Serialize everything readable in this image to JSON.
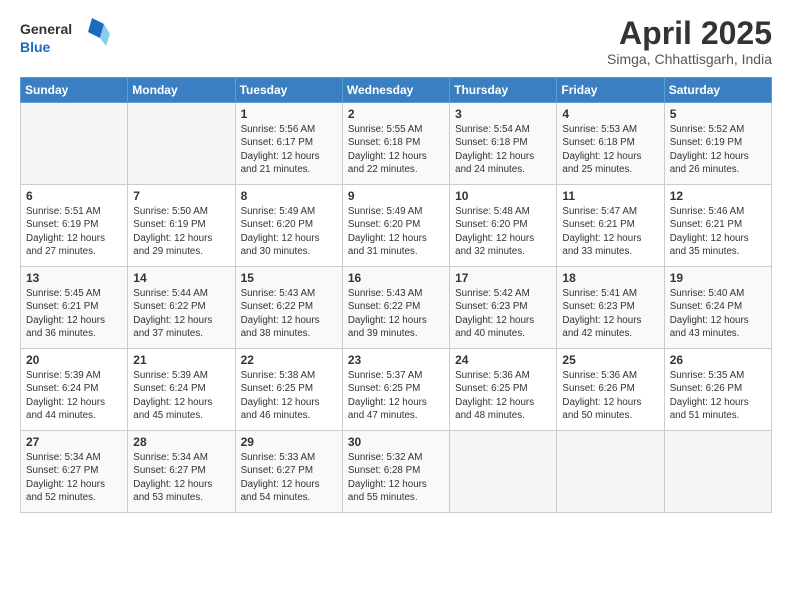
{
  "header": {
    "logo_general": "General",
    "logo_blue": "Blue",
    "month_title": "April 2025",
    "location": "Simga, Chhattisgarh, India"
  },
  "days_of_week": [
    "Sunday",
    "Monday",
    "Tuesday",
    "Wednesday",
    "Thursday",
    "Friday",
    "Saturday"
  ],
  "weeks": [
    [
      {
        "day": "",
        "info": ""
      },
      {
        "day": "",
        "info": ""
      },
      {
        "day": "1",
        "info": "Sunrise: 5:56 AM\nSunset: 6:17 PM\nDaylight: 12 hours and 21 minutes."
      },
      {
        "day": "2",
        "info": "Sunrise: 5:55 AM\nSunset: 6:18 PM\nDaylight: 12 hours and 22 minutes."
      },
      {
        "day": "3",
        "info": "Sunrise: 5:54 AM\nSunset: 6:18 PM\nDaylight: 12 hours and 24 minutes."
      },
      {
        "day": "4",
        "info": "Sunrise: 5:53 AM\nSunset: 6:18 PM\nDaylight: 12 hours and 25 minutes."
      },
      {
        "day": "5",
        "info": "Sunrise: 5:52 AM\nSunset: 6:19 PM\nDaylight: 12 hours and 26 minutes."
      }
    ],
    [
      {
        "day": "6",
        "info": "Sunrise: 5:51 AM\nSunset: 6:19 PM\nDaylight: 12 hours and 27 minutes."
      },
      {
        "day": "7",
        "info": "Sunrise: 5:50 AM\nSunset: 6:19 PM\nDaylight: 12 hours and 29 minutes."
      },
      {
        "day": "8",
        "info": "Sunrise: 5:49 AM\nSunset: 6:20 PM\nDaylight: 12 hours and 30 minutes."
      },
      {
        "day": "9",
        "info": "Sunrise: 5:49 AM\nSunset: 6:20 PM\nDaylight: 12 hours and 31 minutes."
      },
      {
        "day": "10",
        "info": "Sunrise: 5:48 AM\nSunset: 6:20 PM\nDaylight: 12 hours and 32 minutes."
      },
      {
        "day": "11",
        "info": "Sunrise: 5:47 AM\nSunset: 6:21 PM\nDaylight: 12 hours and 33 minutes."
      },
      {
        "day": "12",
        "info": "Sunrise: 5:46 AM\nSunset: 6:21 PM\nDaylight: 12 hours and 35 minutes."
      }
    ],
    [
      {
        "day": "13",
        "info": "Sunrise: 5:45 AM\nSunset: 6:21 PM\nDaylight: 12 hours and 36 minutes."
      },
      {
        "day": "14",
        "info": "Sunrise: 5:44 AM\nSunset: 6:22 PM\nDaylight: 12 hours and 37 minutes."
      },
      {
        "day": "15",
        "info": "Sunrise: 5:43 AM\nSunset: 6:22 PM\nDaylight: 12 hours and 38 minutes."
      },
      {
        "day": "16",
        "info": "Sunrise: 5:43 AM\nSunset: 6:22 PM\nDaylight: 12 hours and 39 minutes."
      },
      {
        "day": "17",
        "info": "Sunrise: 5:42 AM\nSunset: 6:23 PM\nDaylight: 12 hours and 40 minutes."
      },
      {
        "day": "18",
        "info": "Sunrise: 5:41 AM\nSunset: 6:23 PM\nDaylight: 12 hours and 42 minutes."
      },
      {
        "day": "19",
        "info": "Sunrise: 5:40 AM\nSunset: 6:24 PM\nDaylight: 12 hours and 43 minutes."
      }
    ],
    [
      {
        "day": "20",
        "info": "Sunrise: 5:39 AM\nSunset: 6:24 PM\nDaylight: 12 hours and 44 minutes."
      },
      {
        "day": "21",
        "info": "Sunrise: 5:39 AM\nSunset: 6:24 PM\nDaylight: 12 hours and 45 minutes."
      },
      {
        "day": "22",
        "info": "Sunrise: 5:38 AM\nSunset: 6:25 PM\nDaylight: 12 hours and 46 minutes."
      },
      {
        "day": "23",
        "info": "Sunrise: 5:37 AM\nSunset: 6:25 PM\nDaylight: 12 hours and 47 minutes."
      },
      {
        "day": "24",
        "info": "Sunrise: 5:36 AM\nSunset: 6:25 PM\nDaylight: 12 hours and 48 minutes."
      },
      {
        "day": "25",
        "info": "Sunrise: 5:36 AM\nSunset: 6:26 PM\nDaylight: 12 hours and 50 minutes."
      },
      {
        "day": "26",
        "info": "Sunrise: 5:35 AM\nSunset: 6:26 PM\nDaylight: 12 hours and 51 minutes."
      }
    ],
    [
      {
        "day": "27",
        "info": "Sunrise: 5:34 AM\nSunset: 6:27 PM\nDaylight: 12 hours and 52 minutes."
      },
      {
        "day": "28",
        "info": "Sunrise: 5:34 AM\nSunset: 6:27 PM\nDaylight: 12 hours and 53 minutes."
      },
      {
        "day": "29",
        "info": "Sunrise: 5:33 AM\nSunset: 6:27 PM\nDaylight: 12 hours and 54 minutes."
      },
      {
        "day": "30",
        "info": "Sunrise: 5:32 AM\nSunset: 6:28 PM\nDaylight: 12 hours and 55 minutes."
      },
      {
        "day": "",
        "info": ""
      },
      {
        "day": "",
        "info": ""
      },
      {
        "day": "",
        "info": ""
      }
    ]
  ]
}
